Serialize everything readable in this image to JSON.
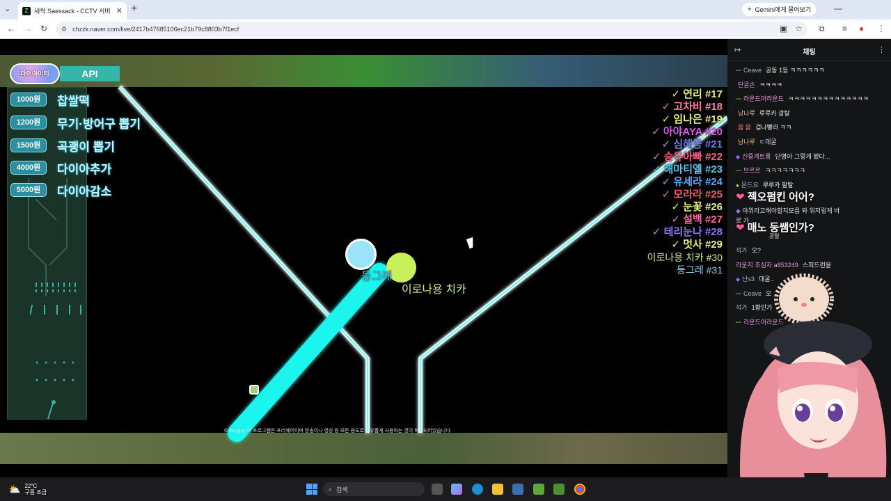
{
  "browser": {
    "tab_title": "새싹 Saessack - CCTV 서버",
    "tab_favicon": "Z",
    "gemini_label": "Gemini에게 물어보기",
    "url": "chzzk.naver.com/live/2417b47685106ec21b79c8803b7f1ecf"
  },
  "stream": {
    "logo_text": "다이아이티",
    "api_label": "API",
    "rewards": [
      {
        "price": "1000원",
        "label": "찹쌀떡"
      },
      {
        "price": "1200원",
        "label": "무기·방어구 뽑기"
      },
      {
        "price": "1500원",
        "label": "곡괭이 뽑기"
      },
      {
        "price": "4000원",
        "label": "다이아추가"
      },
      {
        "price": "5000원",
        "label": "다이아감소"
      }
    ],
    "ball_blue_name": "둥그레",
    "ball_green_name": "이로나용 치카",
    "checklist": [
      {
        "mark": "✓",
        "name": "연리",
        "num": "#17",
        "color": "#e9f27a",
        "mark_color": "#c5f55a"
      },
      {
        "mark": "✓",
        "name": "고차비",
        "num": "#18",
        "color": "#ff7aa8",
        "mark_color": "#e06dd0"
      },
      {
        "mark": "✓",
        "name": "임나은",
        "num": "#19",
        "color": "#e9f27a",
        "mark_color": "#c5f55a"
      },
      {
        "mark": "✓",
        "name": "아야AYA",
        "num": "#20",
        "color": "#d95af0",
        "mark_color": "#e06dd0"
      },
      {
        "mark": "✓",
        "name": "심해뭉",
        "num": "#21",
        "color": "#6d7cf2",
        "mark_color": "#7aa2f7"
      },
      {
        "mark": "✓",
        "name": "승유아빠",
        "num": "#22",
        "color": "#ff5a86",
        "mark_color": "#e06dd0"
      },
      {
        "mark": "✓",
        "name": "해마티엘",
        "num": "#23",
        "color": "#59c7f0",
        "mark_color": "#7aa2f7"
      },
      {
        "mark": "✓",
        "name": "유세라",
        "num": "#24",
        "color": "#5aa8f0",
        "mark_color": "#7aa2f7"
      },
      {
        "mark": "✓",
        "name": "모라라",
        "num": "#25",
        "color": "#f25a6a",
        "mark_color": "#e06dd0"
      },
      {
        "mark": "✓",
        "name": "눈꽃",
        "num": "#26",
        "color": "#e9f27a",
        "mark_color": "#c5f55a"
      },
      {
        "mark": "✓",
        "name": "설백",
        "num": "#27",
        "color": "#ff6aa0",
        "mark_color": "#e06dd0"
      },
      {
        "mark": "✓",
        "name": "테리눈나",
        "num": "#28",
        "color": "#8a7af0",
        "mark_color": "#7aa2f7"
      },
      {
        "mark": "✓",
        "name": "멋사",
        "num": "#29",
        "color": "#e9f27a",
        "mark_color": "#c5f55a"
      }
    ],
    "ranks": [
      {
        "name": "이로나용 치카",
        "num": "#30",
        "color": "#c9f27a"
      },
      {
        "name": "둥그레",
        "num": "#31",
        "color": "#8ad8f5"
      }
    ],
    "watermark": "© lazyguy 이 프로그램은 프리웨어이며 방송이나 영상 등 모든 용도로 자유롭게 사용하는 것이 허용되어있습니다."
  },
  "chat": {
    "title": "채팅",
    "messages": [
      {
        "nick": "Ceave",
        "text": "공동 1등 ㅋㅋㅋㅋㅋㅋ",
        "style": "nick-a",
        "badge": "〰"
      },
      {
        "nick": "단골손",
        "text": "ㅋㅋㅋㅋ",
        "style": "nick-c",
        "badge": ""
      },
      {
        "nick": "라운드어라운드",
        "text": "ㅋㅋㅋㅋㅋㅋㅋㅋㅋㅋㅋㅋㅋㅋ",
        "style": "nick-c",
        "badge": "〰"
      },
      {
        "nick": "낭나루",
        "text": "루루카 광탈",
        "style": "nick-b",
        "badge": ""
      },
      {
        "nick": "음 음",
        "text": "겁나빨라 ㅋㅋ",
        "style": "nick-b",
        "badge": ""
      },
      {
        "nick": "낭나루",
        "text": "ㄷ데굴",
        "style": "nick-b",
        "badge": ""
      },
      {
        "nick": "신중계트롱",
        "text": "단명아 그렇게 됐다...",
        "style": "nick-c",
        "badge": "◆"
      },
      {
        "nick": "브르르",
        "text": "ㅋㅋㅋㅋㅋㅋㅋ",
        "style": "nick-c",
        "badge": "〰"
      },
      {
        "nick": "몬드요",
        "text": "루루카 팔탈",
        "style": "nick-a",
        "badge": "●"
      }
    ],
    "messages2": [
      {
        "nick": "석가",
        "text": "오?",
        "style": "nick-a",
        "badge": ""
      },
      {
        "nick": "라운지 조심자 a853249",
        "text": "스피드런을",
        "style": "nick-c",
        "badge": ""
      },
      {
        "nick": "난s3",
        "text": "데굴..",
        "style": "nick-a",
        "badge": "◆"
      },
      {
        "nick": "Ceave",
        "text": "오",
        "style": "nick-a",
        "badge": "〰"
      },
      {
        "nick": "석가",
        "text": "1황인가",
        "style": "nick-a",
        "badge": ""
      },
      {
        "nick": "라운드어라운드",
        "text": "",
        "style": "nick-c",
        "badge": "〰"
      }
    ],
    "alert1": "젝오펌킨 어어?",
    "alert2_line": "아위라고해야할지모름 와 워저렇게 바",
    "alert2_cont": "로 가",
    "alert3": "매노 둥쌤인가?",
    "alert3_small": "광탈"
  },
  "taskbar": {
    "temp": "22°C",
    "weather_desc": "구름 조금",
    "search_placeholder": "검색"
  }
}
